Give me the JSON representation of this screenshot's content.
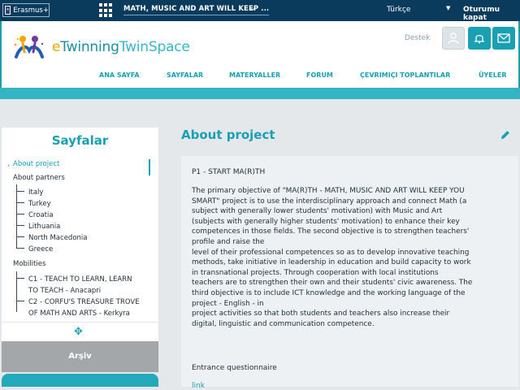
{
  "topbar": {
    "erasmus_label": "Erasmus+",
    "project_title": "MATH, MUSIC AND ART WILL KEEP ...",
    "language": "Türkçe",
    "logout": "Oturumu kapat"
  },
  "header": {
    "logo": {
      "e": "e",
      "twinning": "Twinning",
      "twinspace": "TwinSpace"
    },
    "support": "Destek",
    "icons": [
      "user-icon",
      "bell-icon",
      "mail-icon"
    ],
    "nav": [
      "ANA SAYFA",
      "SAYFALAR",
      "MATERYALLER",
      "FORUM",
      "ÇEVRIMIÇI TOPLANTILAR",
      "ÜYELER"
    ]
  },
  "sidebar": {
    "title": "Sayfalar",
    "items": [
      {
        "label": "About project",
        "active": true
      },
      {
        "label": "About partners"
      },
      {
        "label": "Italy"
      },
      {
        "label": "Turkey"
      },
      {
        "label": "Croatia"
      },
      {
        "label": "Lithuania"
      },
      {
        "label": "North Macedonia"
      },
      {
        "label": "Greece"
      },
      {
        "label": "Mobilities"
      },
      {
        "label": "C1 - TEACH TO LEARN, LEARN"
      },
      {
        "label": "TO TEACH - Anacapri"
      },
      {
        "label": "C2 - CORFU'S TREASURE TROVE"
      },
      {
        "label": "OF MATH AND ARTS - Kerkyra"
      }
    ],
    "archive": "Arşiv"
  },
  "main": {
    "title": "About project",
    "heading": "P1 - START MA(R)TH",
    "body": "The primary objective of \"MA(R)TH - MATH, MUSIC AND ART WILL KEEP YOU\nSMART\" project is to use the interdisciplinary approach and connect Math (a\nsubject with generally lower students' motivation) with Music and Art\n(subjects with generally higher students' motivation) to enhance their key\ncompetences in those fields. The second objective is to strengthen teachers'\nprofile and raise the\nlevel of their professional competences so as to develop innovative teaching\nmethods, take initiative in leadership in education and build capacity to work\nin transnational projects. Through cooperation with local institutions\nteachers are to strengthen their own and their students' civic awareness. The\nthird objective is to include ICT knowledge and the working language of the\nproject - English - in\nproject activities so that both students and teachers also increase their\ndigital, linguistic and communication competence.",
    "entrance": "Entrance questionnaire",
    "link": "link"
  },
  "colors": {
    "accent": "#17a0b2",
    "topbar": "#0b3b5c",
    "archive": "#a4a7aa"
  }
}
